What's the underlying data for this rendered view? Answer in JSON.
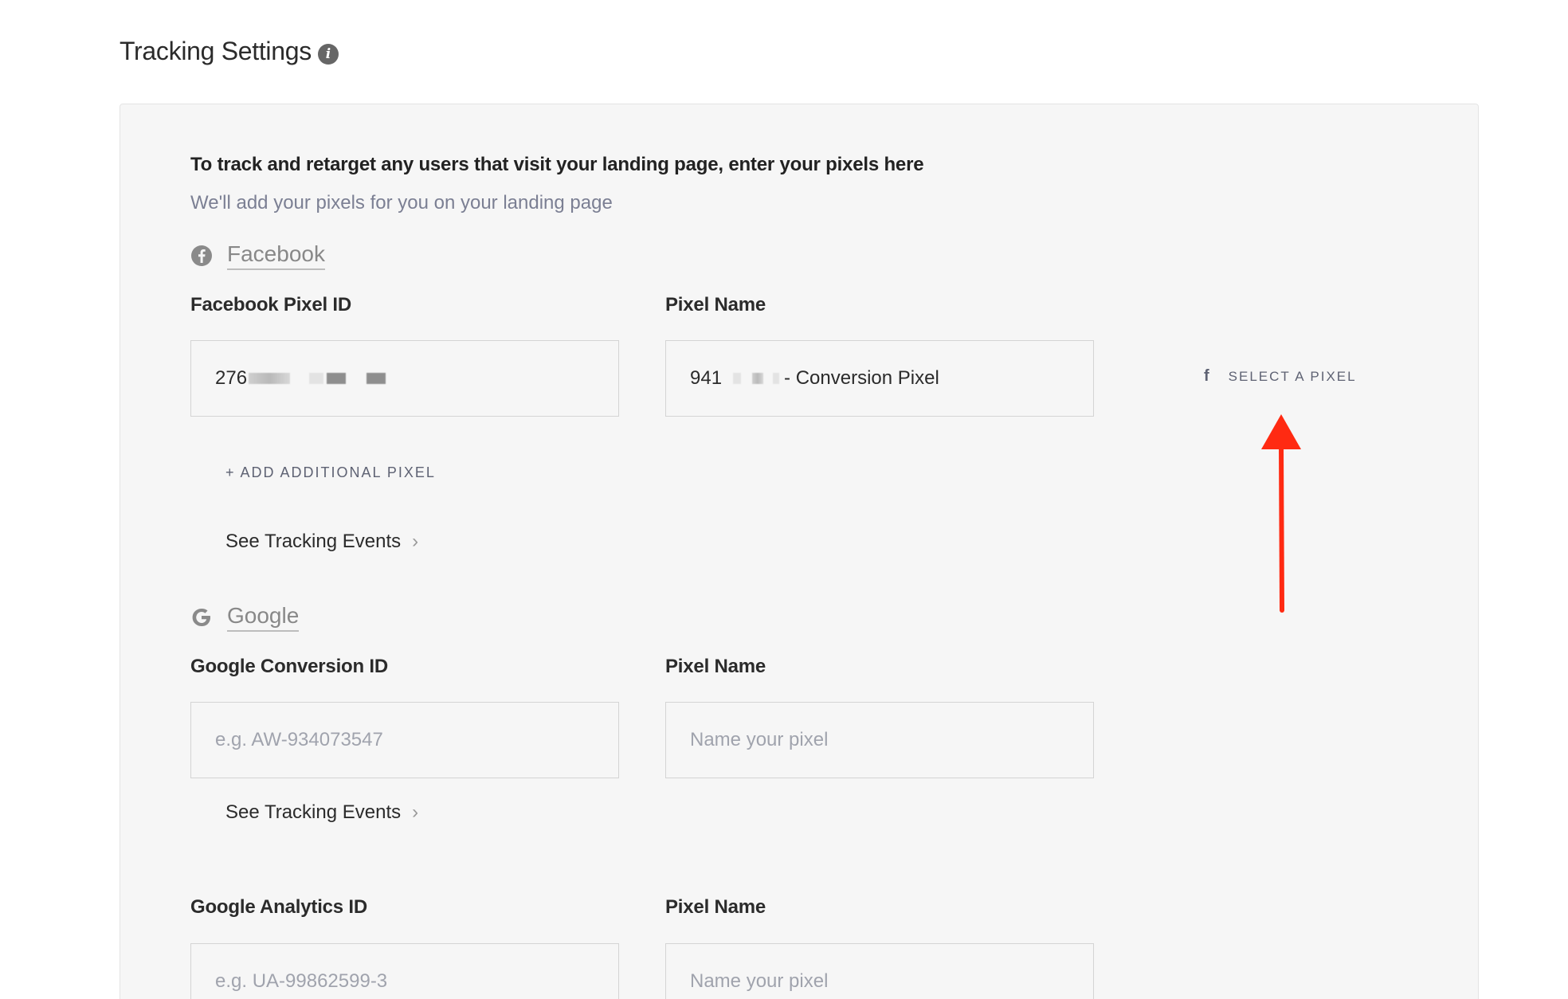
{
  "page": {
    "title": "Tracking Settings",
    "info_icon": "info-icon"
  },
  "panel": {
    "intro": "To track and retarget any users that visit your landing page, enter your pixels here",
    "subtext": "We'll add your pixels for you on your landing page"
  },
  "facebook": {
    "provider_name": "Facebook",
    "provider_icon": "facebook-icon",
    "pixel_id_label": "Facebook Pixel ID",
    "pixel_id_value_prefix": "276",
    "pixel_name_label": "Pixel Name",
    "pixel_name_value_prefix": "941",
    "pixel_name_value_suffix": "- Conversion Pixel",
    "select_pixel_label": "SELECT A PIXEL",
    "add_pixel_label": "+ ADD ADDITIONAL PIXEL",
    "see_events_label": "See Tracking Events"
  },
  "google": {
    "provider_name": "Google",
    "provider_icon": "google-icon",
    "conversion_id_label": "Google Conversion ID",
    "conversion_id_placeholder": "e.g. AW-934073547",
    "conversion_pixel_name_label": "Pixel Name",
    "conversion_pixel_name_placeholder": "Name your pixel",
    "see_events_label": "See Tracking Events",
    "analytics_id_label": "Google Analytics ID",
    "analytics_id_placeholder": "e.g. UA-99862599-3",
    "analytics_pixel_name_label": "Pixel Name",
    "analytics_pixel_name_placeholder": "Name your pixel"
  },
  "colors": {
    "annotation_arrow": "#ff2a12",
    "panel_background": "#f6f6f6",
    "muted_text": "#7b7f93"
  }
}
